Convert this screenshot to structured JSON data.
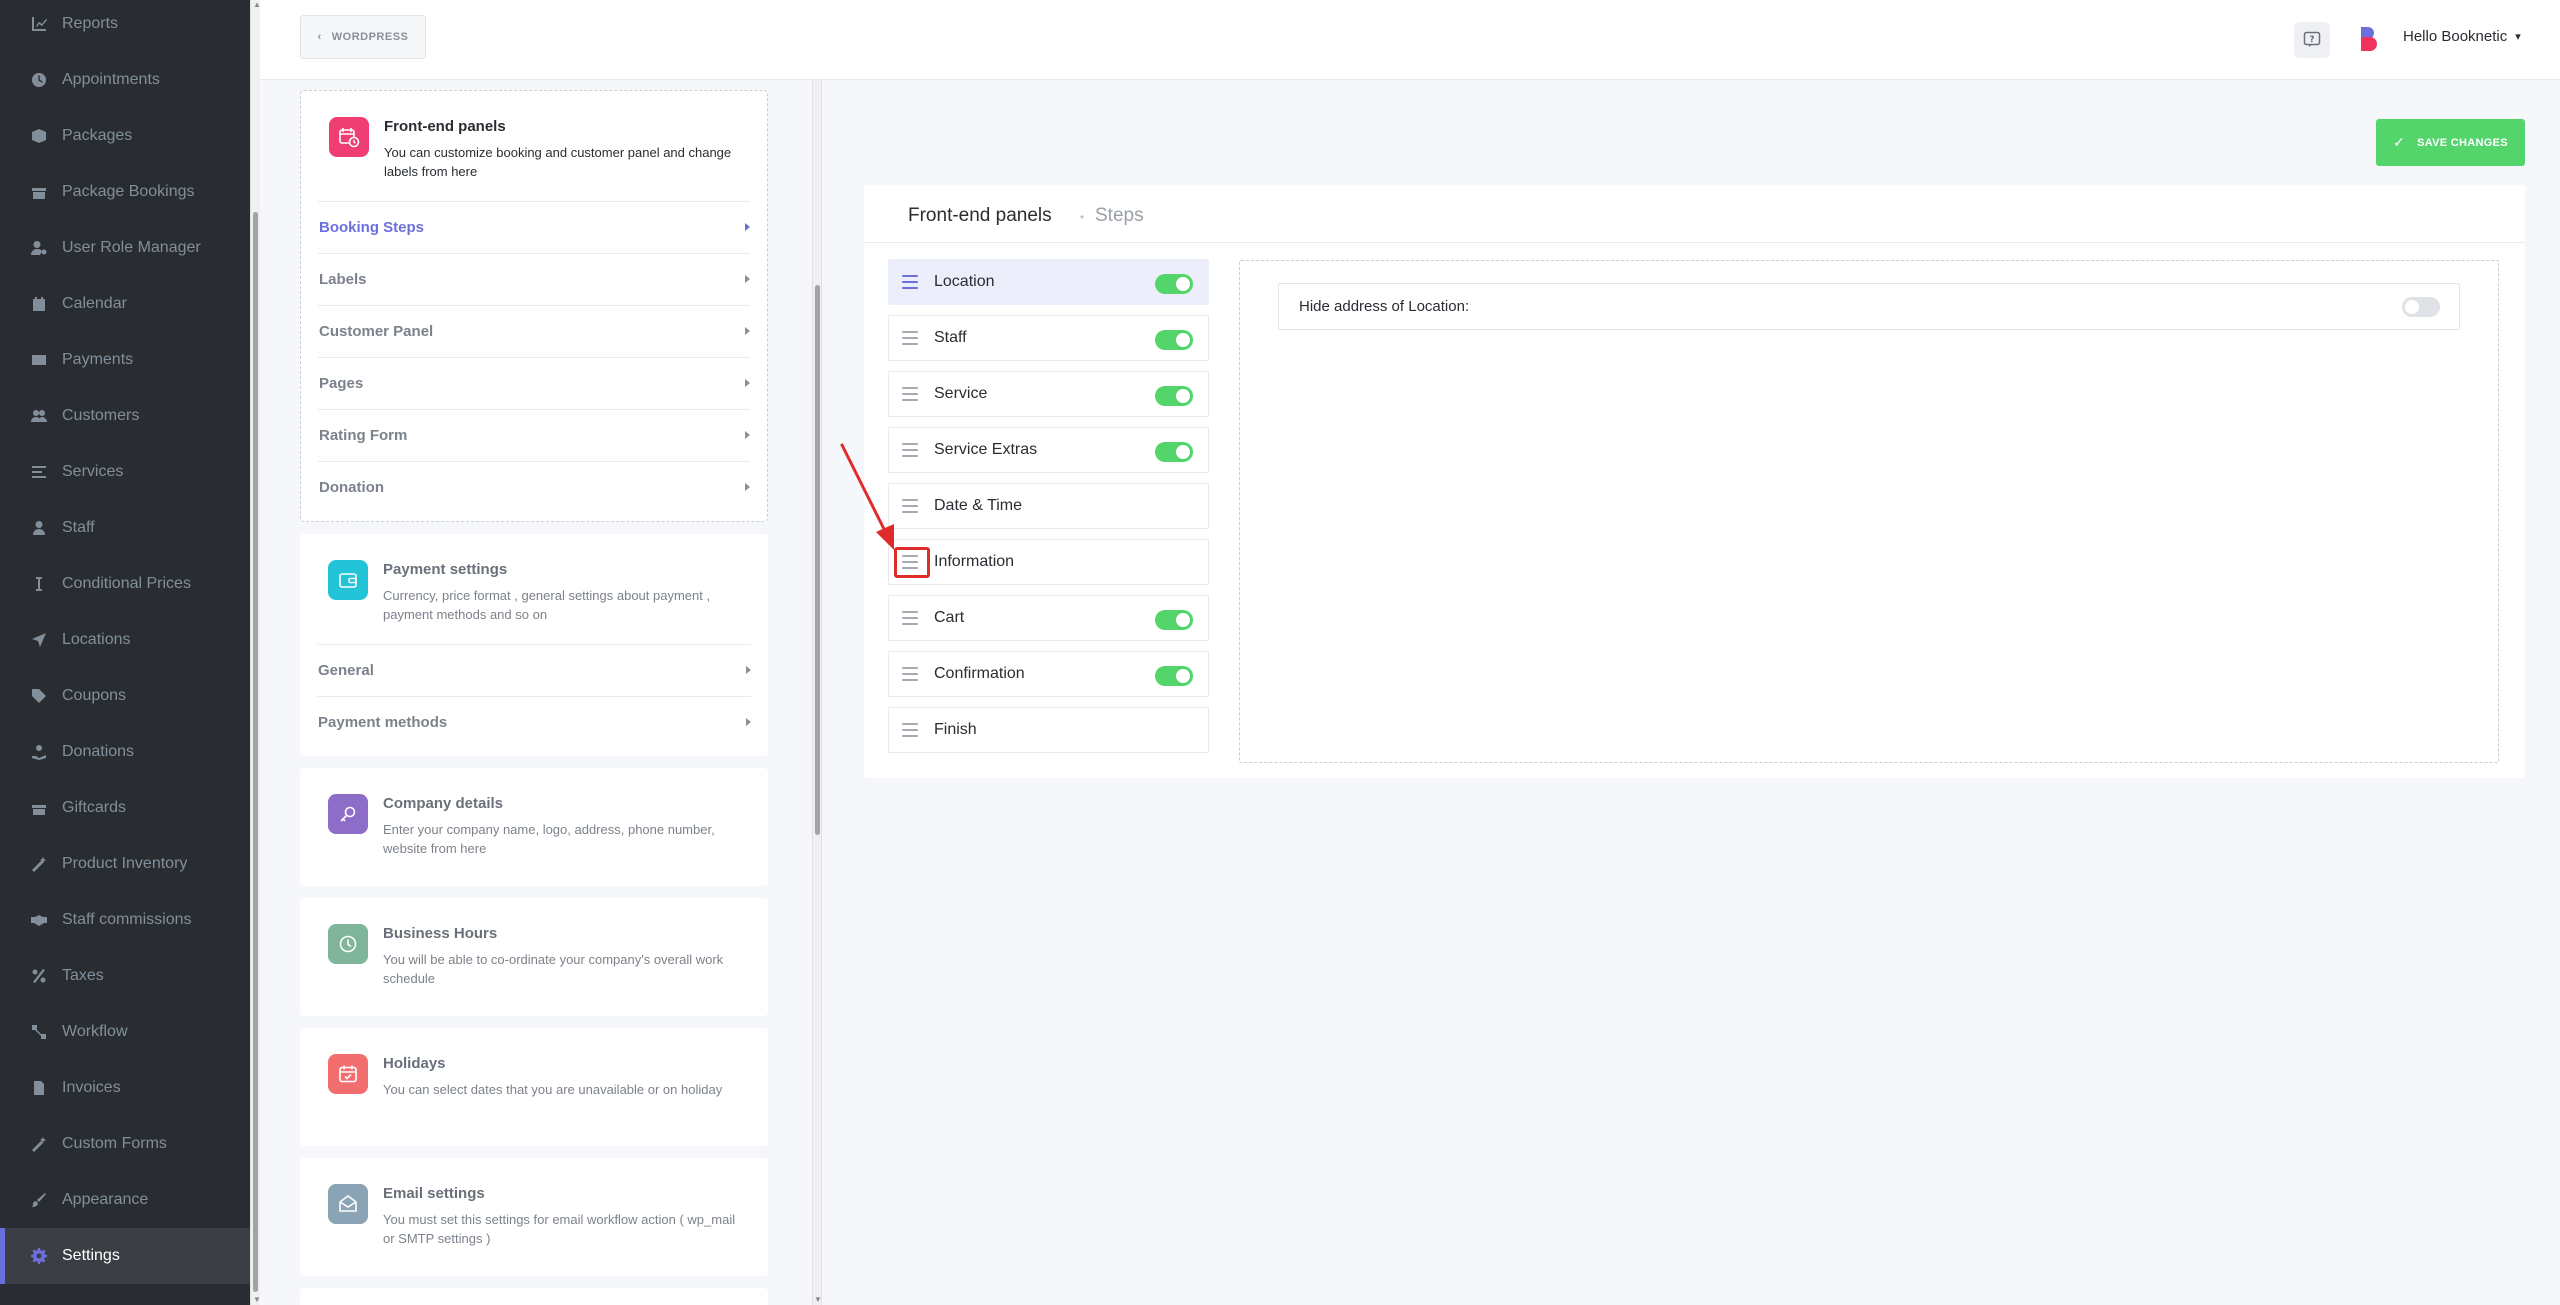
{
  "sidebar": {
    "items": [
      {
        "label": "Reports",
        "icon": "chart-icon"
      },
      {
        "label": "Appointments",
        "icon": "clock-icon"
      },
      {
        "label": "Packages",
        "icon": "package-icon"
      },
      {
        "label": "Package Bookings",
        "icon": "box-icon"
      },
      {
        "label": "User Role Manager",
        "icon": "user-cog-icon"
      },
      {
        "label": "Calendar",
        "icon": "calendar-icon"
      },
      {
        "label": "Payments",
        "icon": "credit-card-icon"
      },
      {
        "label": "Customers",
        "icon": "users-icon"
      },
      {
        "label": "Services",
        "icon": "list-icon"
      },
      {
        "label": "Staff",
        "icon": "user-icon"
      },
      {
        "label": "Conditional Prices",
        "icon": "cursor-icon"
      },
      {
        "label": "Locations",
        "icon": "location-arrow-icon"
      },
      {
        "label": "Coupons",
        "icon": "tag-icon"
      },
      {
        "label": "Donations",
        "icon": "donation-icon"
      },
      {
        "label": "Giftcards",
        "icon": "gift-icon"
      },
      {
        "label": "Product Inventory",
        "icon": "wand-icon"
      },
      {
        "label": "Staff commissions",
        "icon": "handshake-icon"
      },
      {
        "label": "Taxes",
        "icon": "percent-icon"
      },
      {
        "label": "Workflow",
        "icon": "workflow-icon"
      },
      {
        "label": "Invoices",
        "icon": "invoice-icon"
      },
      {
        "label": "Custom Forms",
        "icon": "magic-icon"
      },
      {
        "label": "Appearance",
        "icon": "brush-icon"
      },
      {
        "label": "Settings",
        "icon": "gear-icon",
        "active": true
      }
    ]
  },
  "topbar": {
    "back_label": "WORDPRESS",
    "user_label": "Hello Booknetic"
  },
  "settings": {
    "frontend": {
      "title": "Front-end panels",
      "desc": "You can customize booking and customer panel and change labels from here",
      "items": [
        "Booking Steps",
        "Labels",
        "Customer Panel",
        "Pages",
        "Rating Form",
        "Donation"
      ]
    },
    "payment": {
      "title": "Payment settings",
      "desc": "Currency, price format , general settings about payment , payment methods and so on",
      "items": [
        "General",
        "Payment methods"
      ]
    },
    "company": {
      "title": "Company details",
      "desc": "Enter your company name, logo, address, phone number, website from here"
    },
    "hours": {
      "title": "Business Hours",
      "desc": "You will be able to co-ordinate your company's overall work schedule"
    },
    "holidays": {
      "title": "Holidays",
      "desc": "You can select dates that you are unavailable or on holiday"
    },
    "email": {
      "title": "Email settings",
      "desc": "You must set this settings for email workflow action ( wp_mail or SMTP settings )"
    }
  },
  "panel": {
    "save_label": "SAVE CHANGES",
    "title": "Front-end panels",
    "subtitle": "Steps",
    "steps": [
      {
        "label": "Location",
        "toggle": true,
        "active": true
      },
      {
        "label": "Staff",
        "toggle": true
      },
      {
        "label": "Service",
        "toggle": true
      },
      {
        "label": "Service Extras",
        "toggle": true
      },
      {
        "label": "Date & Time",
        "toggle": null
      },
      {
        "label": "Information",
        "toggle": null
      },
      {
        "label": "Cart",
        "toggle": true
      },
      {
        "label": "Confirmation",
        "toggle": true
      },
      {
        "label": "Finish",
        "toggle": null
      }
    ],
    "detail": {
      "label": "Hide address of Location:",
      "toggle": false
    }
  },
  "colors": {
    "accent": "#6c70dc",
    "success": "#53d56c",
    "sidebar_bg": "#292d32",
    "highlight": "#e02b2b"
  }
}
